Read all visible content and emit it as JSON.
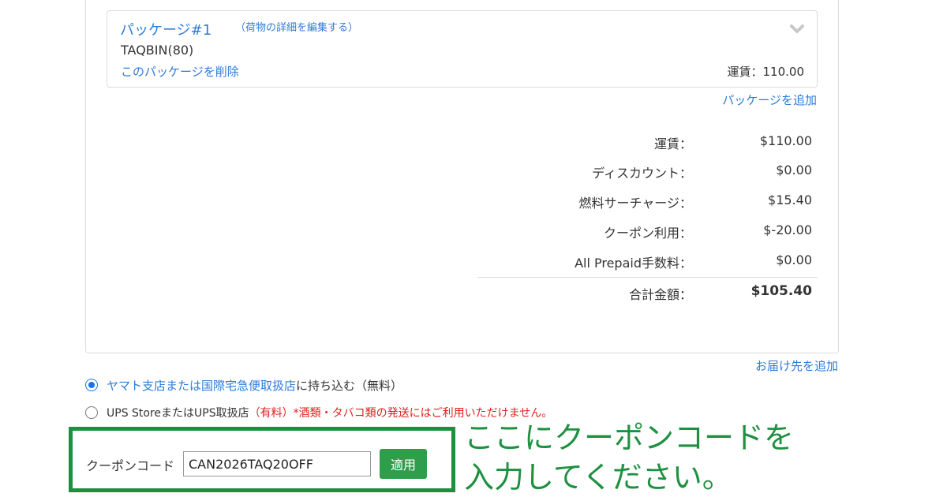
{
  "package": {
    "title": "パッケージ#1",
    "edit_link": "（荷物の詳細を編集する）",
    "service": "TAQBIN(80)",
    "delete_link": "このパッケージを削除",
    "fare": "運賃：110.00"
  },
  "add_package_link": "パッケージを追加",
  "summary": [
    {
      "label": "運賃：",
      "value": "$110.00"
    },
    {
      "label": "ディスカウント：",
      "value": "$0.00"
    },
    {
      "label": "燃料サーチャージ：",
      "value": "$15.40"
    },
    {
      "label": "クーポン利用：",
      "value": "$-20.00"
    },
    {
      "label": "All Prepaid手数料：",
      "value": "$0.00"
    }
  ],
  "total": {
    "label": "合計金額：",
    "value": "$105.40"
  },
  "add_address_link": "お届け先を追加",
  "options": {
    "yamato": {
      "link": "ヤマト支店または国際宅急便取扱店",
      "text": "に持ち込む（無料）",
      "selected": true
    },
    "ups": {
      "text": "UPS StoreまたはUPS取扱店",
      "paid": "（有料）",
      "note": "*酒類・タバコ類の発送にはご利用いただけません。",
      "selected": false
    }
  },
  "coupon": {
    "label": "クーポンコード",
    "value": "CAN2026TAQ20OFF",
    "apply_label": "適用"
  },
  "callout": {
    "line1": "ここにクーポンコードを",
    "line2": "入力してください。"
  },
  "colors": {
    "link": "#2f7bd6",
    "accent_green": "#1e8f3e",
    "button_green": "#2e9e4a",
    "warning_red": "#e02020"
  }
}
